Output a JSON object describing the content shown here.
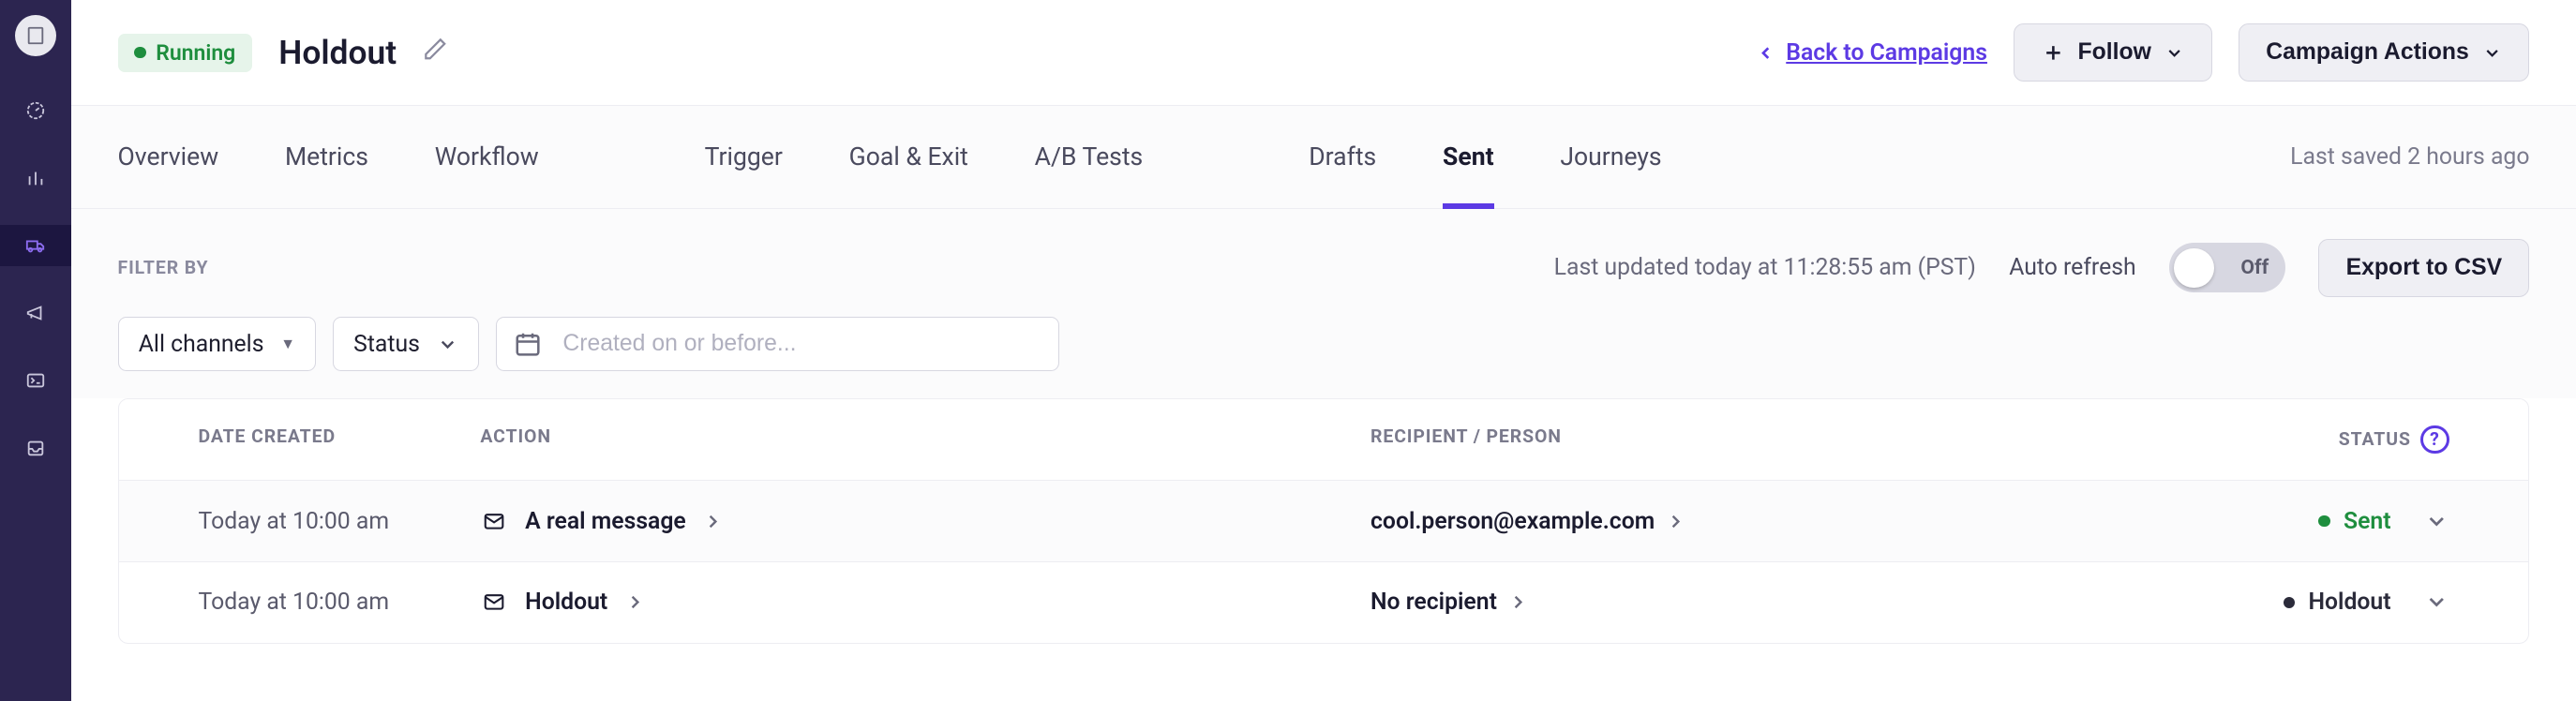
{
  "header": {
    "status": "Running",
    "title": "Holdout",
    "back_link": "Back to Campaigns",
    "follow_btn": "Follow",
    "actions_btn": "Campaign Actions"
  },
  "tabs": {
    "group1": [
      "Overview",
      "Metrics",
      "Workflow"
    ],
    "group2": [
      "Trigger",
      "Goal & Exit",
      "A/B Tests"
    ],
    "group3": [
      "Drafts",
      "Sent",
      "Journeys"
    ],
    "active": "Sent",
    "last_saved": "Last saved 2 hours ago"
  },
  "filter": {
    "label": "FILTER BY",
    "last_updated": "Last updated today at 11:28:55 am (PST)",
    "auto_refresh_label": "Auto refresh",
    "toggle_state": "Off",
    "export_btn": "Export to CSV",
    "channels": "All channels",
    "status": "Status",
    "date_placeholder": "Created on or before..."
  },
  "table": {
    "columns": {
      "date": "DATE CREATED",
      "action": "ACTION",
      "recipient": "RECIPIENT / PERSON",
      "status": "STATUS"
    },
    "rows": [
      {
        "date": "Today at 10:00 am",
        "action": "A real message",
        "recipient": "cool.person@example.com",
        "status": "Sent",
        "status_kind": "sent"
      },
      {
        "date": "Today at 10:00 am",
        "action": "Holdout",
        "recipient": "No recipient",
        "status": "Holdout",
        "status_kind": "holdout"
      }
    ]
  }
}
